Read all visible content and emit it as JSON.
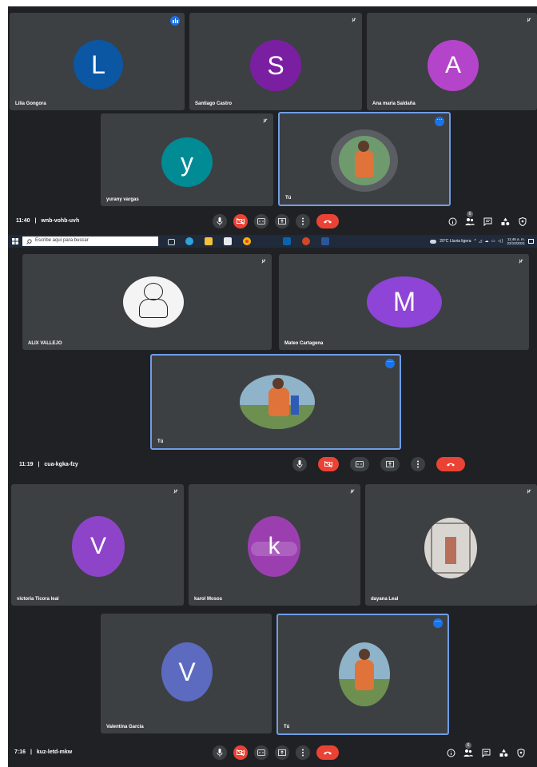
{
  "screen1": {
    "participants": [
      {
        "name": "Lilia Gongora",
        "initial": "L",
        "color": "#0b57a4"
      },
      {
        "name": "Santiago Castro",
        "initial": "S",
        "color": "#7b1fa2"
      },
      {
        "name": "Ana maria Saldaña",
        "initial": "A",
        "color": "#b444c9"
      },
      {
        "name": "yurany vargas",
        "initial": "y",
        "color": "#008b95"
      },
      {
        "name": "Tú"
      }
    ],
    "time": "11:40",
    "meeting_code": "wnb-vohb-uvh",
    "separator": "|",
    "people_count": "6"
  },
  "taskbar": {
    "search_placeholder": "Escribe aquí para buscar",
    "weather": "20°C  Lluvia ligera",
    "clock_time": "11:46 a. m.",
    "clock_date": "22/10/2021"
  },
  "screen2": {
    "participants": [
      {
        "name": "ALIX VALLEJO"
      },
      {
        "name": "Mateo Cartagena",
        "initial": "M",
        "color": "#8e44d6"
      },
      {
        "name": "Tú"
      }
    ],
    "time": "11:19",
    "meeting_code": "cua-kgka-fzy",
    "separator": "|"
  },
  "screen3": {
    "participants": [
      {
        "name": "victoria Ticora leal",
        "initial": "V",
        "color": "#8e44c9"
      },
      {
        "name": "karol Mosos",
        "initial": "k",
        "color": "#9b3fb0"
      },
      {
        "name": "dayana Leal"
      },
      {
        "name": "Valentina Garcia",
        "initial": "V",
        "color": "#5c6bc0"
      },
      {
        "name": "Tú"
      }
    ],
    "time": "7:16",
    "meeting_code": "kuz-letd-mkw",
    "separator": "|",
    "people_count": "6"
  },
  "colors": {
    "background": "#202124",
    "tile": "#3c4043",
    "self_border": "#6f9de6",
    "end_call": "#ea4335",
    "accent": "#1a73e8"
  },
  "icons": [
    "mic-icon",
    "camera-off-icon",
    "captions-icon",
    "present-icon",
    "more-icon",
    "end-call-icon",
    "info-icon",
    "people-icon",
    "chat-icon",
    "activities-icon",
    "host-controls-icon",
    "mic-off-icon",
    "windows-icon",
    "search-icon"
  ]
}
